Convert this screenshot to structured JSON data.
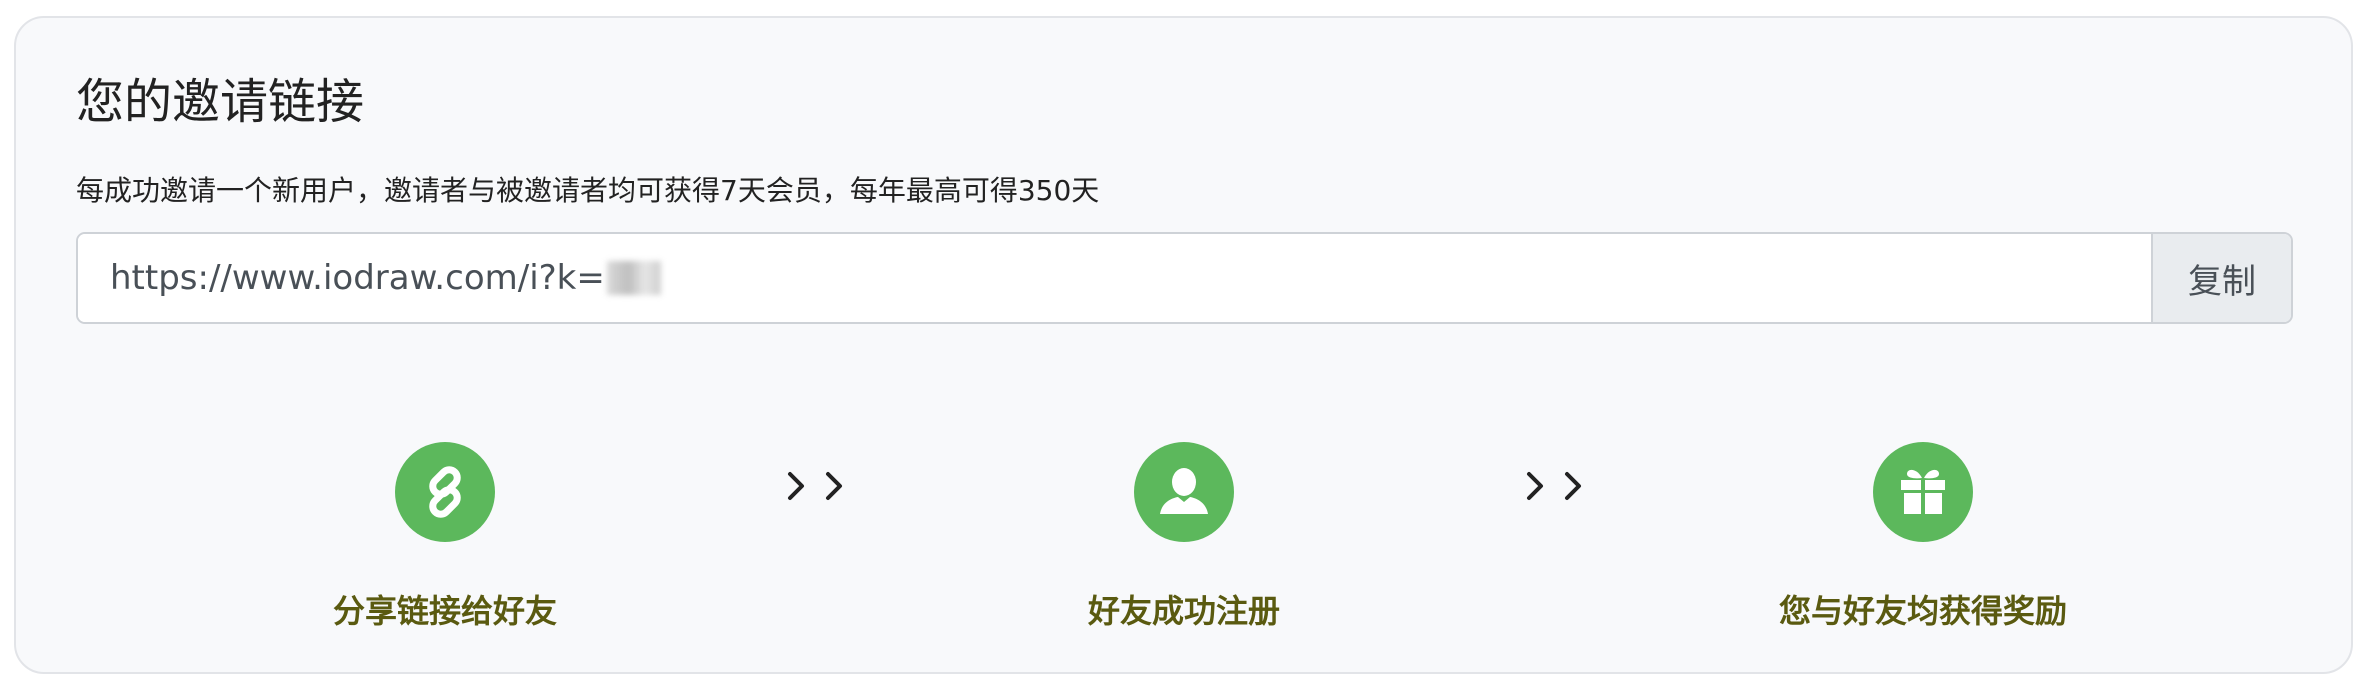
{
  "invite": {
    "title": "您的邀请链接",
    "description": "每成功邀请一个新用户，邀请者与被邀请者均可获得7天会员，每年最高可得350天",
    "link_value": "https://www.iodraw.com/i?k=",
    "copy_label": "复制"
  },
  "steps": [
    {
      "label": "分享链接给好友",
      "icon": "link-icon"
    },
    {
      "label": "好友成功注册",
      "icon": "user-icon"
    },
    {
      "label": "您与好友均获得奖励",
      "icon": "gift-icon"
    }
  ],
  "colors": {
    "icon_bg": "#5cb85c",
    "step_label": "#5a5a10"
  }
}
